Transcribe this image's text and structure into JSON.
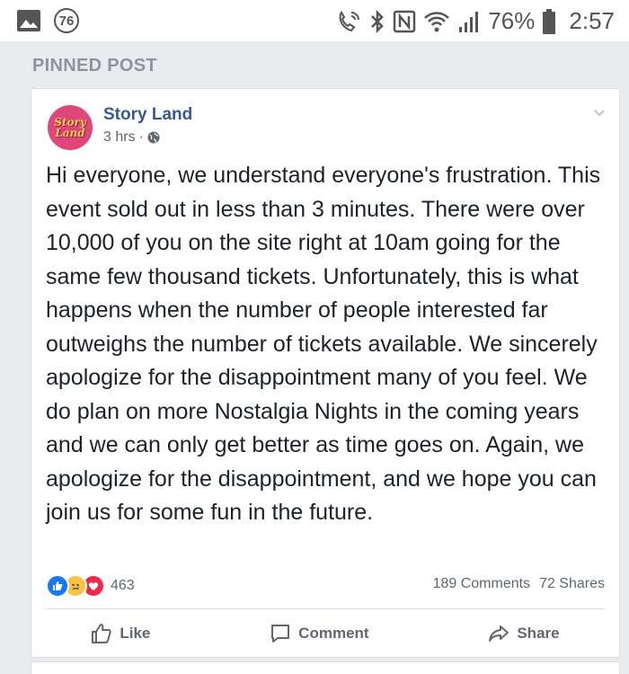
{
  "status_bar": {
    "notification_count": "76",
    "battery_percent": "76%",
    "time": "2:57",
    "icons": [
      "gallery-icon",
      "wifi-call-icon",
      "bluetooth-icon",
      "nfc-icon",
      "wifi-icon",
      "signal-icon",
      "battery-icon"
    ]
  },
  "section": {
    "label": "PINNED POST"
  },
  "post": {
    "page_name": "Story Land",
    "avatar_text_top": "Story",
    "avatar_text_bottom": "Land",
    "time": "3 hrs",
    "separator": "·",
    "body": "Hi everyone, we understand everyone's frustration. This event sold out in less than 3 minutes. There were over 10,000 of you on the site right at 10am going for the same few thousand tickets. Unfortunately, this is what happens when the number of people interested far outweighs the number of tickets available. We sincerely apologize for the disappointment many of you feel. We do plan on more Nostalgia Nights in the coming years and we can only get better as time goes on. Again, we apologize for the disappointment, and we hope you can join us for some fun in the future.",
    "reactions_count": "463",
    "comments": "189 Comments",
    "shares": "72 Shares"
  },
  "actions": {
    "like": "Like",
    "comment": "Comment",
    "share": "Share"
  },
  "colors": {
    "link": "#365899",
    "like_blue": "#1877f2",
    "love_red": "#f0284a",
    "sad_yellow": "#f7c543",
    "avatar_pink": "#e0457b"
  }
}
